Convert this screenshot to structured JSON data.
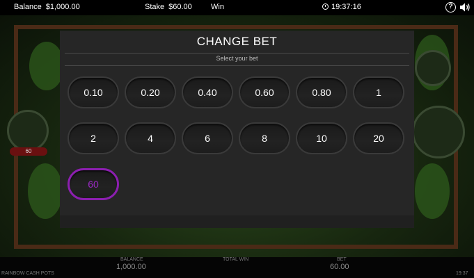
{
  "topbar": {
    "balance_label": "Balance",
    "balance_value": "$1,000.00",
    "stake_label": "Stake",
    "stake_value": "$60.00",
    "win_label": "Win",
    "clock": "19:37:16",
    "help_glyph": "?"
  },
  "modal": {
    "title": "CHANGE BET",
    "subtitle": "Select your bet",
    "bets": [
      "0.10",
      "0.20",
      "0.40",
      "0.60",
      "0.80",
      "1",
      "2",
      "4",
      "6",
      "8",
      "10",
      "20",
      "60"
    ],
    "selected": "60",
    "selected_color": "#8c1fb0"
  },
  "background": {
    "side_badge": "60"
  },
  "bottombar": {
    "game_name": "RAINBOW CASH POTS",
    "balance_label": "BALANCE",
    "balance_value": "1,000.00",
    "total_win_label": "TOTAL WIN",
    "bet_label": "BET",
    "bet_value": "60.00",
    "clock_short": "19:37"
  },
  "colors": {
    "modal_bg": "#262626",
    "topbar_bg": "#000000",
    "selected_accent": "#8c1fb0"
  }
}
